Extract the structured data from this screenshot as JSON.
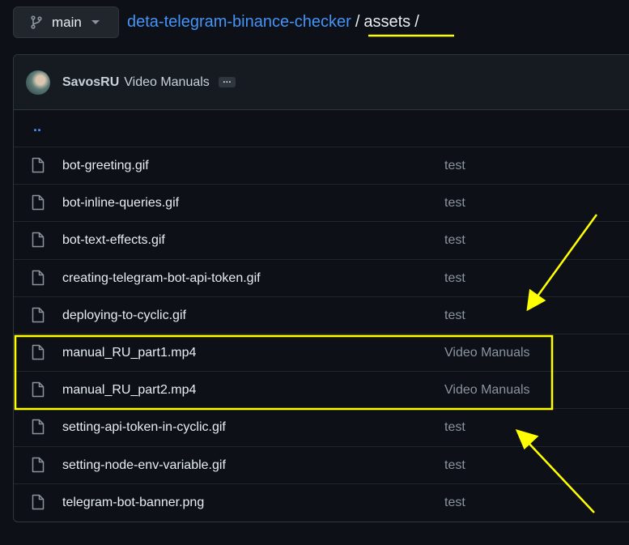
{
  "branch": {
    "name": "main"
  },
  "breadcrumb": {
    "repo": "deta-telegram-binance-checker",
    "separator": "/",
    "current": "assets"
  },
  "commit": {
    "author": "SavosRU",
    "message": "Video Manuals",
    "more": "…"
  },
  "parent_link": "..",
  "files": [
    {
      "name": "bot-greeting.gif",
      "commit": "test"
    },
    {
      "name": "bot-inline-queries.gif",
      "commit": "test"
    },
    {
      "name": "bot-text-effects.gif",
      "commit": "test"
    },
    {
      "name": "creating-telegram-bot-api-token.gif",
      "commit": "test"
    },
    {
      "name": "deploying-to-cyclic.gif",
      "commit": "test"
    },
    {
      "name": "manual_RU_part1.mp4",
      "commit": "Video Manuals"
    },
    {
      "name": "manual_RU_part2.mp4",
      "commit": "Video Manuals"
    },
    {
      "name": "setting-api-token-in-cyclic.gif",
      "commit": "test"
    },
    {
      "name": "setting-node-env-variable.gif",
      "commit": "test"
    },
    {
      "name": "telegram-bot-banner.png",
      "commit": "test"
    }
  ],
  "colors": {
    "background": "#0d1117",
    "link": "#4493f8",
    "annotation": "#ffff00"
  }
}
